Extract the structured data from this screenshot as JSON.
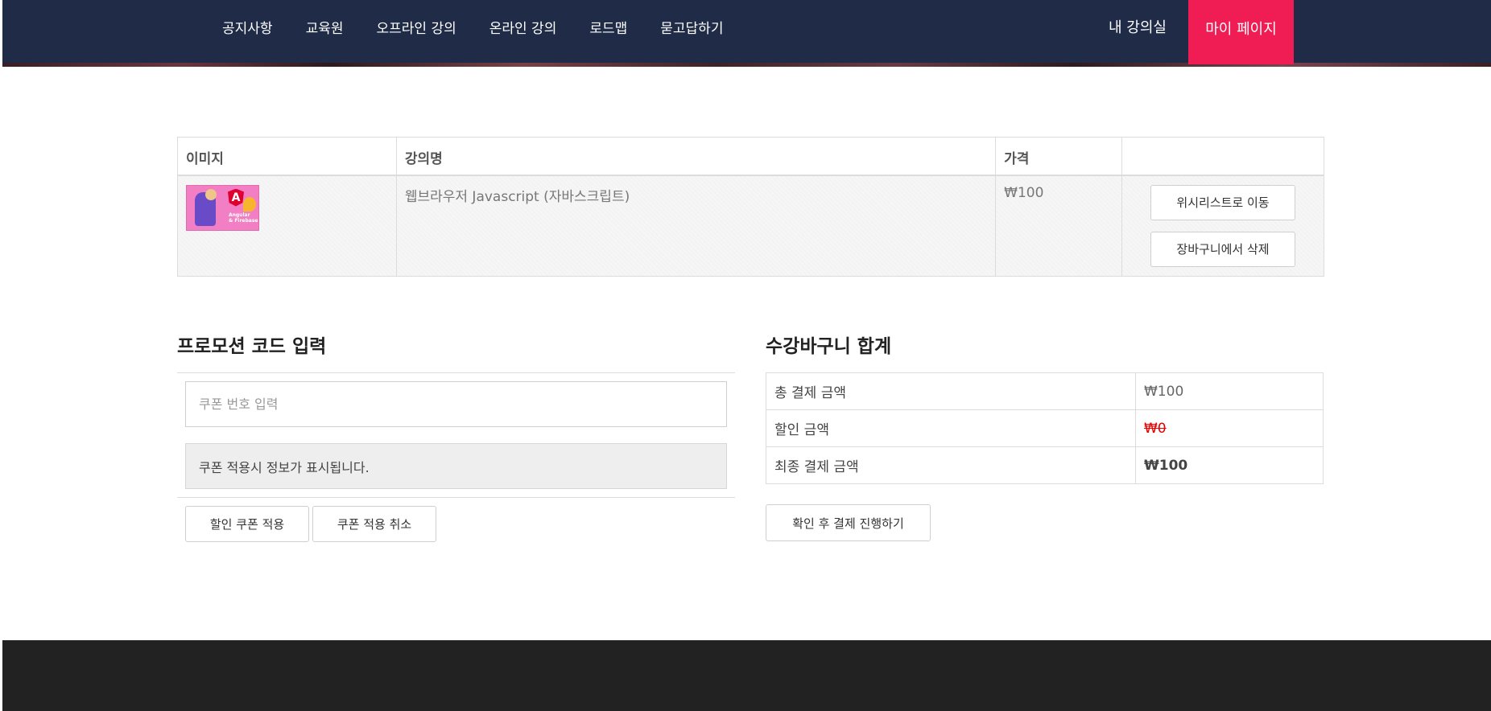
{
  "header": {
    "nav": [
      "공지사항",
      "교육원",
      "오프라인 강의",
      "온라인 강의",
      "로드맵",
      "묻고답하기"
    ],
    "my_class": "내 강의실",
    "my_page": "마이 페이지"
  },
  "cart": {
    "columns": [
      "이미지",
      "강의명",
      "가격",
      ""
    ],
    "rows": [
      {
        "thumbnail_text": [
          "Angular",
          "& Firebase"
        ],
        "thumbnail_badge": "A",
        "title": "웹브라우저 Javascript (자바스크립트)",
        "price": "₩100",
        "wishlist_label": "위시리스트로 이동",
        "remove_label": "장바구니에서 삭제"
      }
    ]
  },
  "promo": {
    "title": "프로모션 코드 입력",
    "input_placeholder": "쿠폰 번호 입력",
    "info_text": "쿠폰 적용시 정보가 표시됩니다.",
    "apply_label": "할인 쿠폰 적용",
    "cancel_label": "쿠폰 적용 취소"
  },
  "totals": {
    "title": "수강바구니 합계",
    "rows": [
      {
        "label": "총 결제 금액",
        "value": "₩100"
      },
      {
        "label": "할인 금액",
        "value": "₩0"
      },
      {
        "label": "최종 결제 금액",
        "value": "₩100"
      }
    ],
    "checkout_label": "확인 후 결제 진행하기"
  },
  "colors": {
    "header_bg": "#1f2b47",
    "accent": "#f01c54",
    "discount": "#e60000",
    "footer_bg": "#222222"
  }
}
